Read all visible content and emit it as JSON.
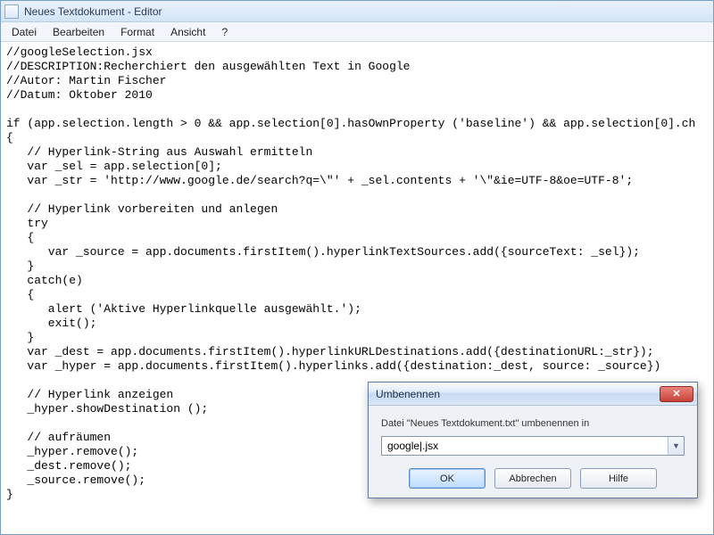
{
  "window": {
    "title": "Neues Textdokument - Editor"
  },
  "menu": {
    "file": "Datei",
    "edit": "Bearbeiten",
    "format": "Format",
    "view": "Ansicht",
    "help": "?"
  },
  "editor": {
    "content": "//googleSelection.jsx\n//DESCRIPTION:Recherchiert den ausgewählten Text in Google\n//Autor: Martin Fischer\n//Datum: Oktober 2010\n\nif (app.selection.length > 0 && app.selection[0].hasOwnProperty ('baseline') && app.selection[0].ch\n{\n   // Hyperlink-String aus Auswahl ermitteln\n   var _sel = app.selection[0];\n   var _str = 'http://www.google.de/search?q=\\\"' + _sel.contents + '\\\"&ie=UTF-8&oe=UTF-8';\n\n   // Hyperlink vorbereiten und anlegen\n   try\n   {\n      var _source = app.documents.firstItem().hyperlinkTextSources.add({sourceText: _sel});\n   }\n   catch(e)\n   {\n      alert ('Aktive Hyperlinkquelle ausgewählt.');\n      exit();\n   }\n   var _dest = app.documents.firstItem().hyperlinkURLDestinations.add({destinationURL:_str});\n   var _hyper = app.documents.firstItem().hyperlinks.add({destination:_dest, source: _source})\n\n   // Hyperlink anzeigen\n   _hyper.showDestination ();\n\n   // aufräumen\n   _hyper.remove();\n   _dest.remove();\n   _source.remove();\n}"
  },
  "dialog": {
    "title": "Umbenennen",
    "prompt": "Datei \"Neues Textdokument.txt\" umbenennen in",
    "input_value": "google|.jsx",
    "ok": "OK",
    "cancel": "Abbrechen",
    "help": "Hilfe",
    "close_glyph": "✕"
  }
}
